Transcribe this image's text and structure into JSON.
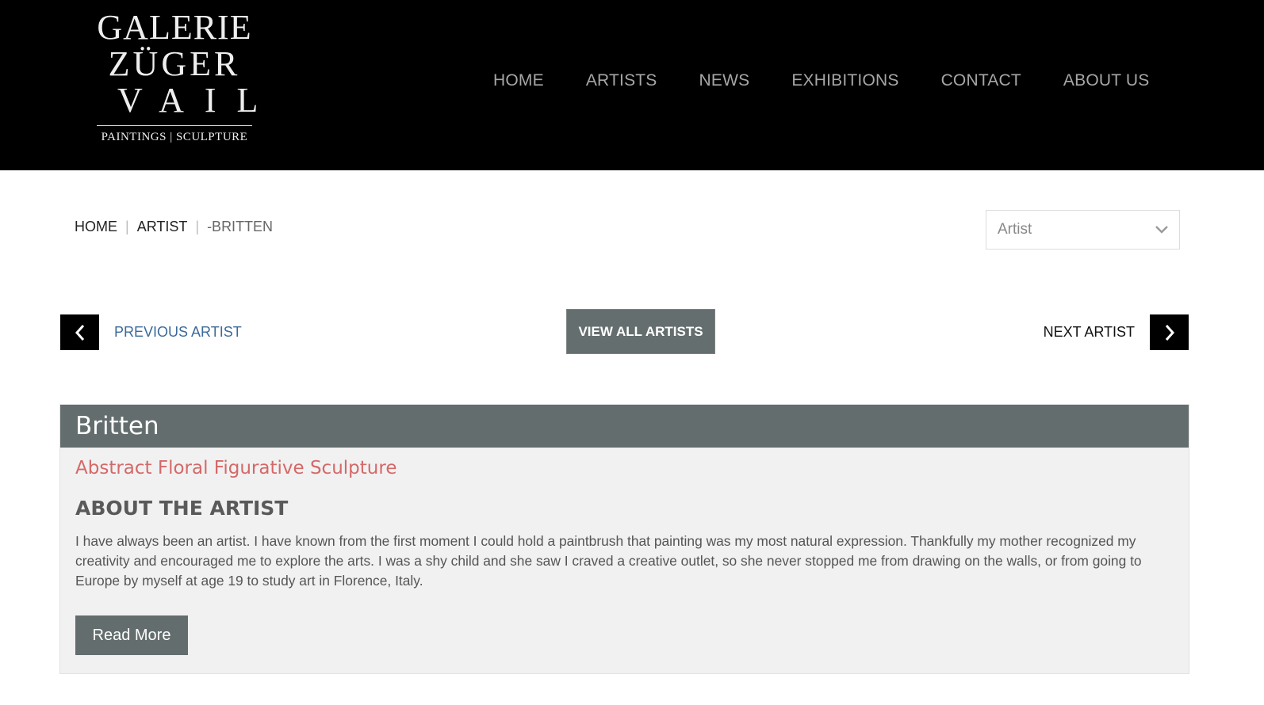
{
  "logo": {
    "line1": "GALERIE",
    "line2": "ZÜGER",
    "line3": "VAIL",
    "tagline": "PAINTINGS | SCULPTURE"
  },
  "nav": {
    "items": [
      {
        "label": "HOME"
      },
      {
        "label": "ARTISTS"
      },
      {
        "label": "NEWS"
      },
      {
        "label": "EXHIBITIONS"
      },
      {
        "label": "CONTACT"
      },
      {
        "label": "ABOUT US"
      }
    ]
  },
  "breadcrumb": {
    "home": "HOME",
    "artist": "ARTIST",
    "current": "-BRITTEN",
    "separator": "|"
  },
  "artist_select": {
    "value": "Artist",
    "icon": "chevron-down-icon"
  },
  "pager": {
    "previous_label": "PREVIOUS ARTIST",
    "next_label": "NEXT ARTIST",
    "view_all_label": "VIEW ALL ARTISTS",
    "previous_icon": "chevron-left-icon",
    "next_icon": "chevron-right-icon"
  },
  "artist": {
    "name": "Britten",
    "categories": "Abstract Floral Figurative Sculpture",
    "about_heading": "ABOUT THE ARTIST",
    "bio": "I have always been an artist. I have known from the first moment I could hold a paintbrush that painting was my most natural expression. Thankfully my mother recognized my creativity and encouraged me to explore the arts. I was a shy child and she saw I craved a creative outlet, so she never stopped me from drawing on the walls, or from going to Europe by myself at age 19 to study art in Florence, Italy.",
    "read_more_label": "Read More"
  },
  "colors": {
    "header_bg": "#000000",
    "nav_text": "#a6a6a6",
    "panel_head": "#646d6d",
    "categories": "#d56868",
    "prev_link": "#3a6a9b"
  }
}
